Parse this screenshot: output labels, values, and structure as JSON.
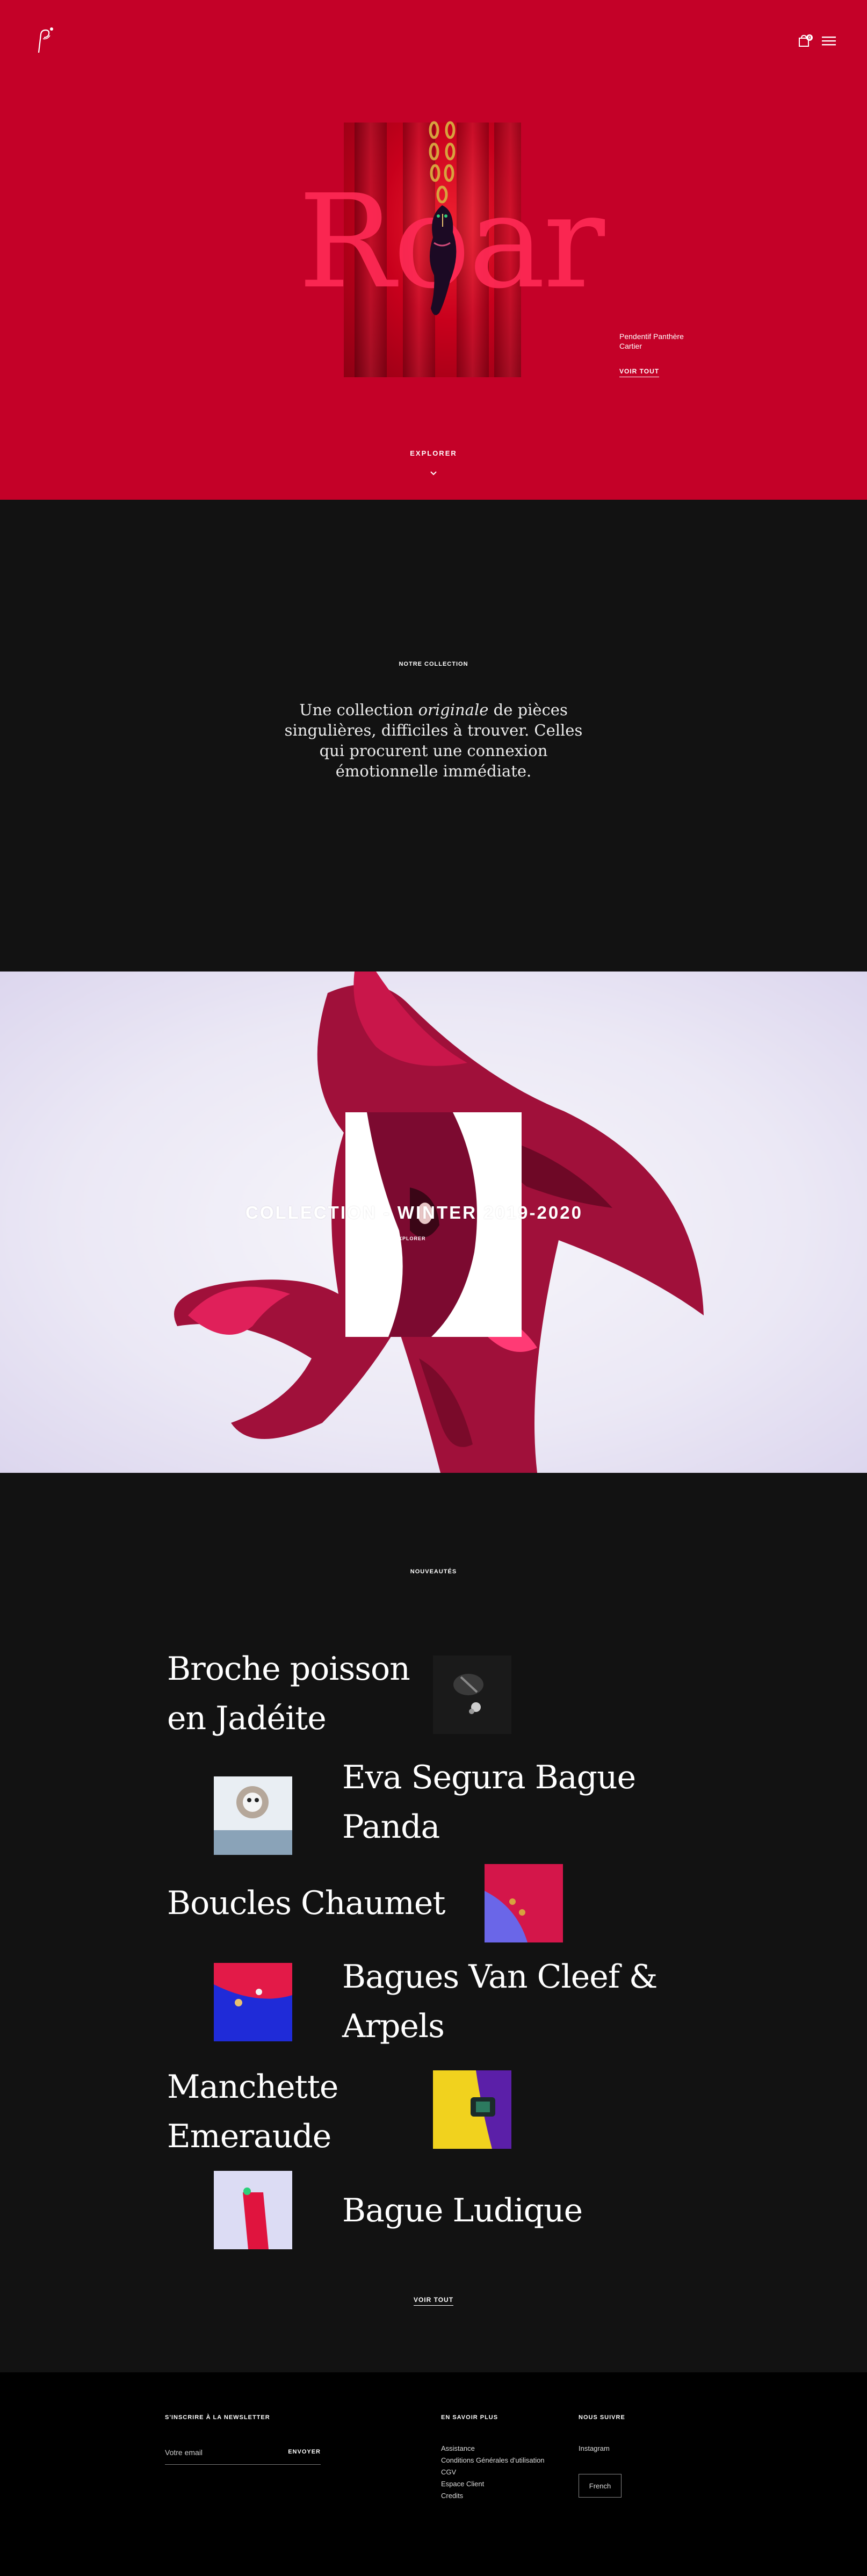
{
  "header": {
    "logo_icon": "brand-monogram-icon",
    "cart_icon": "shopping-bag-icon",
    "cart_count": "0",
    "menu_icon": "hamburger-icon"
  },
  "hero": {
    "word": "Roar",
    "caption_line1": "Pendentif Panthère",
    "caption_line2": "Cartier",
    "link": "VOIR TOUT",
    "explore": "EXPLORER",
    "chevron_icon": "chevron-down-icon",
    "accent": "#c40128"
  },
  "intro": {
    "eyebrow": "NOTRE COLLECTION",
    "text_before": "Une collection ",
    "text_emph": "originale",
    "text_after": " de pièces singulières, difficiles à trouver. Celles qui procurent une connexion émotionnelle immédiate."
  },
  "banner": {
    "title": "COLLECTION - WINTER 2019-2020",
    "sub": "EXPLORER"
  },
  "news": {
    "eyebrow": "NOUVEAUTÉS",
    "items": [
      {
        "title": "Broche poisson en Jadéite"
      },
      {
        "title": "Eva Segura Bague Panda"
      },
      {
        "title": "Boucles Chaumet"
      },
      {
        "title": "Bagues Van Cleef & Arpels"
      },
      {
        "title": "Manchette Emeraude"
      },
      {
        "title": "Bague Ludique"
      }
    ],
    "more": "VOIR TOUT"
  },
  "footer": {
    "newsletter_heading": "S'INSCRIRE À LA NEWSLETTER",
    "email_placeholder": "Votre email",
    "send_label": "ENVOYER",
    "info_heading": "EN SAVOIR PLUS",
    "info_links": [
      "Assistance",
      "Conditions Générales d'utilisation",
      "CGV",
      "Espace Client",
      "Credits"
    ],
    "follow_heading": "NOUS SUIVRE",
    "follow_links": [
      "Instagram"
    ],
    "language": "French"
  }
}
